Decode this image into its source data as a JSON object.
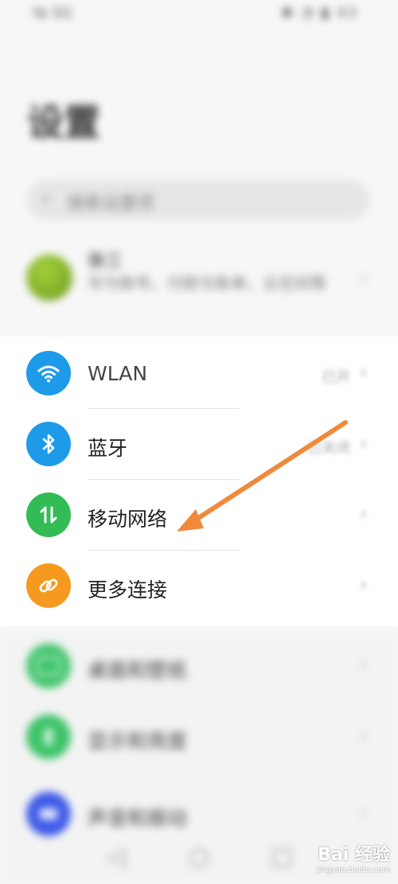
{
  "status_bar": {
    "left": "Ya 5G",
    "right": "✱ ◔ ▮ 43"
  },
  "page": {
    "title": "设置"
  },
  "search": {
    "placeholder": "搜索设置项"
  },
  "account": {
    "name": "张三",
    "description": "华为账号、付款与账单、云空间等"
  },
  "connectivity": [
    {
      "label": "WLAN",
      "value": "已开",
      "color": "#1e9be8",
      "icon": "wifi-icon"
    },
    {
      "label": "蓝牙",
      "value": "已关闭",
      "color": "#1e9be8",
      "icon": "bluetooth-icon"
    },
    {
      "label": "移动网络",
      "value": "",
      "color": "#33bb55",
      "icon": "mobile-data-icon"
    },
    {
      "label": "更多连接",
      "value": "",
      "color": "#f59a1e",
      "icon": "link-icon"
    }
  ],
  "display": [
    {
      "label": "桌面和壁纸",
      "color": "#3ec46a",
      "icon": "image-icon"
    },
    {
      "label": "显示和亮度",
      "color": "#3ec46a",
      "icon": "brightness-icon"
    },
    {
      "label": "声音和振动",
      "color": "#3d5ae8",
      "icon": "sound-icon"
    }
  ],
  "nav": {
    "back": "◁",
    "home": "○",
    "recents": "□"
  },
  "watermark": {
    "main": "Bai 经验",
    "sub": "jingyan.baidu.com"
  },
  "annotation": {
    "arrow_color": "#f08a3a"
  }
}
